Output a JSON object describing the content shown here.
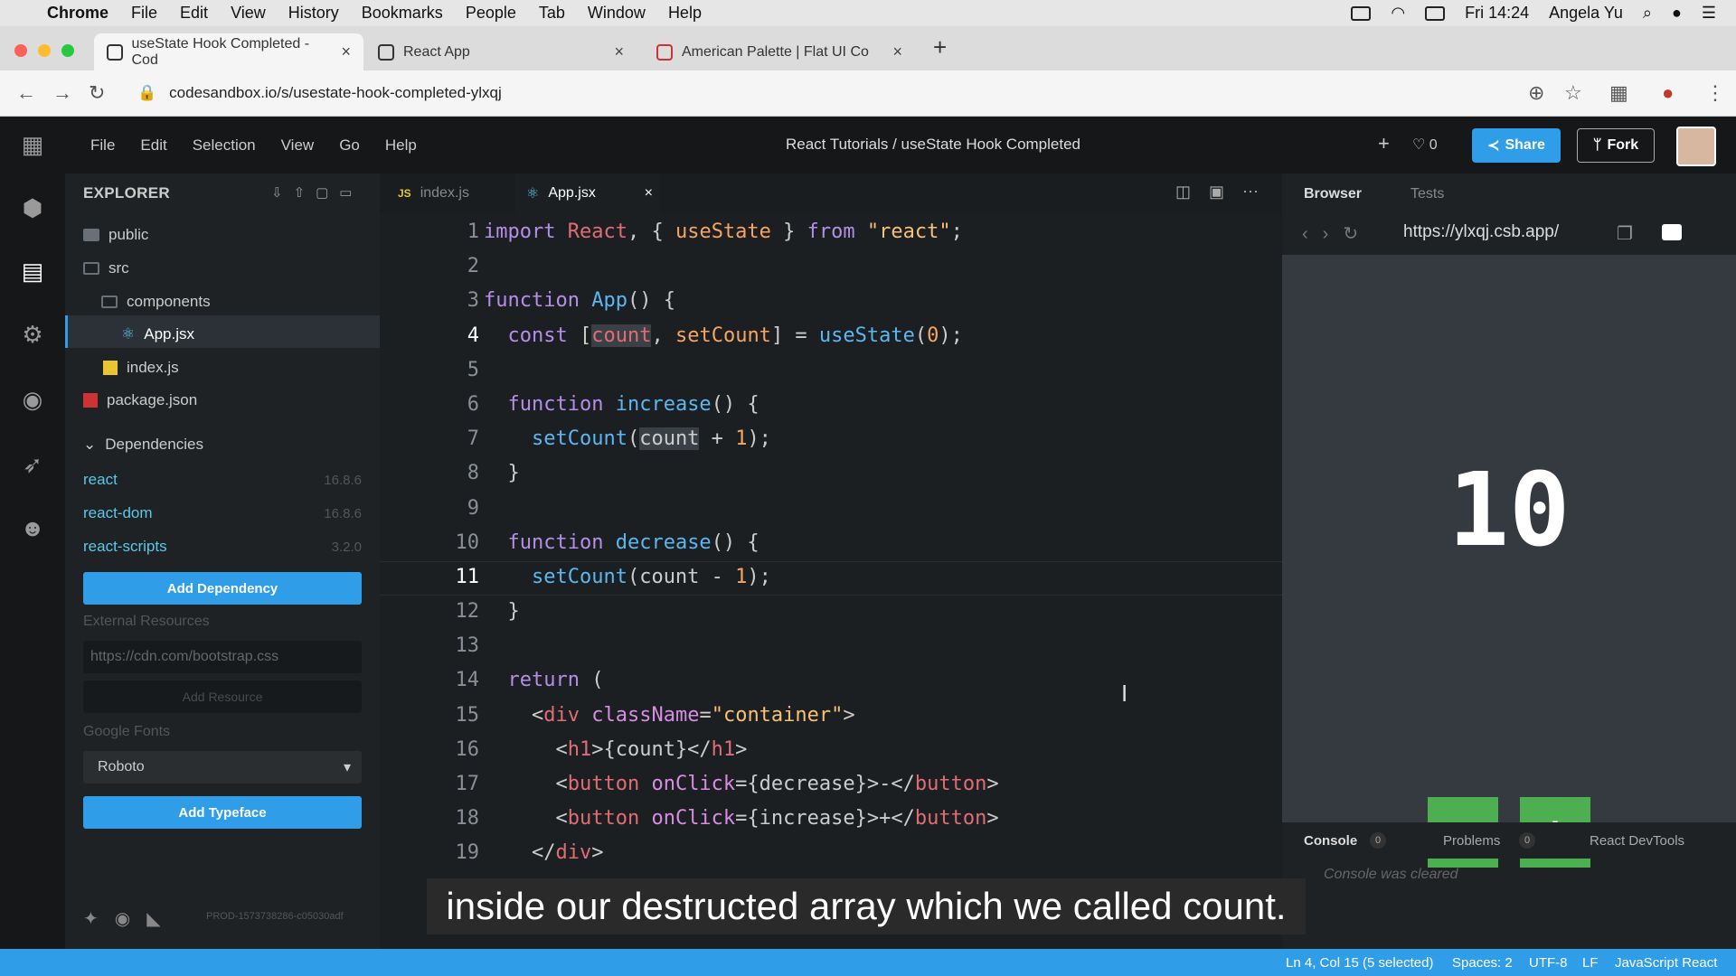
{
  "menubar": {
    "app": "Chrome",
    "items": [
      "File",
      "Edit",
      "View",
      "History",
      "Bookmarks",
      "People",
      "Tab",
      "Window",
      "Help"
    ],
    "clock": "Fri 14:24",
    "user": "Angela Yu"
  },
  "tabs": [
    {
      "title": "useState Hook Completed - Cod"
    },
    {
      "title": "React App"
    },
    {
      "title": "American Palette | Flat UI Co"
    }
  ],
  "address": {
    "url": "codesandbox.io/s/usestate-hook-completed-ylxqj"
  },
  "csb": {
    "menu": [
      "File",
      "Edit",
      "Selection",
      "View",
      "Go",
      "Help"
    ],
    "title": "React Tutorials / useState Hook Completed",
    "likes": "0",
    "share": "Share",
    "fork": "Fork"
  },
  "explorer": {
    "title": "EXPLORER",
    "files": [
      "public",
      "src",
      "components",
      "App.jsx",
      "index.js",
      "package.json"
    ],
    "deps_title": "Dependencies",
    "deps": [
      {
        "name": "react",
        "version": "16.8.6"
      },
      {
        "name": "react-dom",
        "version": "16.8.6"
      },
      {
        "name": "react-scripts",
        "version": "3.2.0"
      }
    ],
    "add_dependency": "Add Dependency",
    "external_resources": "External Resources",
    "resource_placeholder": "https://cdn.com/bootstrap.css",
    "add_resource": "Add Resource",
    "google_fonts": "Google Fonts",
    "font_value": "Roboto",
    "add_typeface": "Add Typeface",
    "build": "PROD-1573738286-c05030adf"
  },
  "editor": {
    "tabs": [
      "index.js",
      "App.jsx"
    ],
    "line_numbers": [
      "1",
      "2",
      "3",
      "4",
      "5",
      "6",
      "7",
      "8",
      "9",
      "10",
      "11",
      "12",
      "13",
      "14",
      "15",
      "16",
      "17",
      "18",
      "19"
    ]
  },
  "browser": {
    "tabs": [
      "Browser",
      "Tests"
    ],
    "url": "https://ylxqj.csb.app/",
    "count": "10",
    "minus": "-",
    "plus": "+",
    "console_tabs": [
      "Console",
      "Problems",
      "React DevTools"
    ],
    "console_count": "0",
    "problems_count": "0",
    "console_msg": "Console was cleared"
  },
  "status": {
    "position": "Ln 4, Col 15 (5 selected)",
    "spaces": "Spaces: 2",
    "encoding": "UTF-8",
    "eol": "LF",
    "lang": "JavaScript React"
  },
  "caption": "inside our destructed array which we called count.",
  "colors": {
    "accent": "#2f9de8",
    "button_green": "#4caf50",
    "preview_bg": "#343a40"
  }
}
